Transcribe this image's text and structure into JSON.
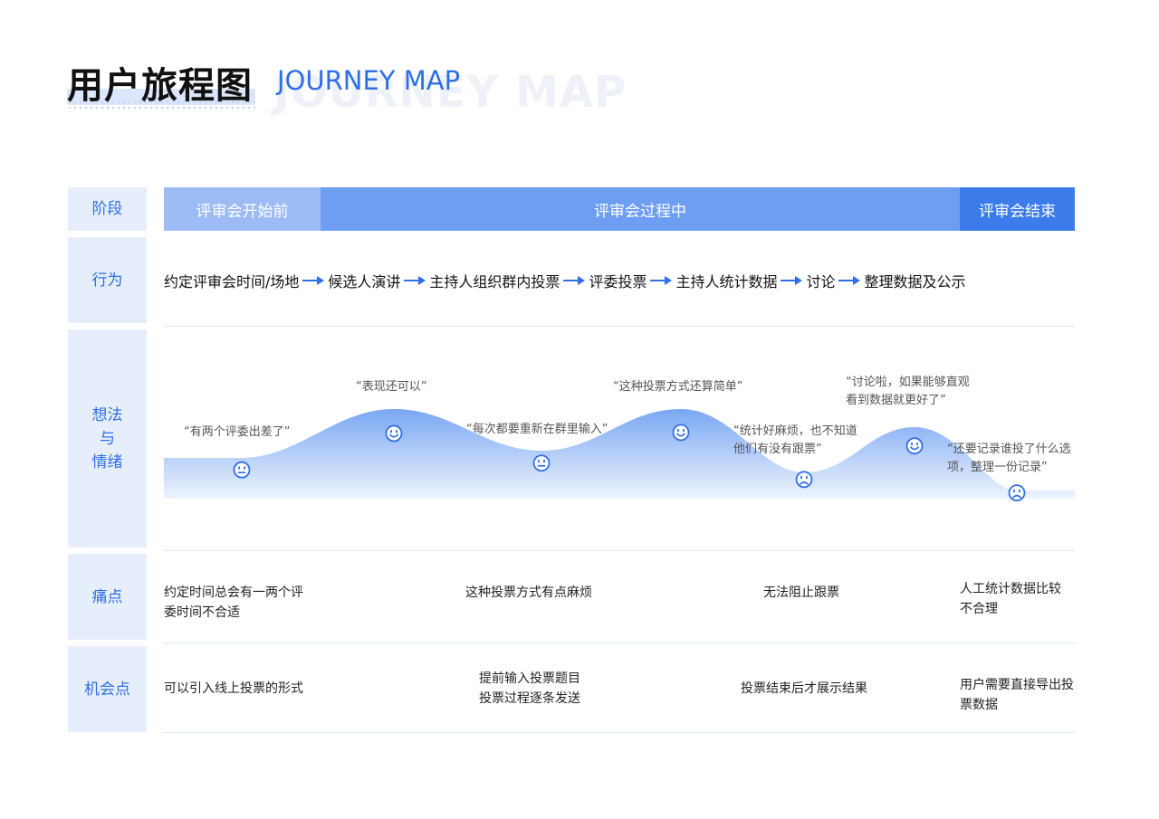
{
  "header": {
    "title_cn": "用户旅程图",
    "title_en": "JOURNEY MAP",
    "title_en_ghost": "JOURNEY MAP"
  },
  "labels": {
    "stage": "阶段",
    "action": "行为",
    "thought_line1": "想法",
    "thought_line2": "与",
    "thought_line3": "情绪",
    "pain": "痛点",
    "opportunity": "机会点"
  },
  "stages": [
    {
      "label": "评审会开始前",
      "color": "#9dbcf6"
    },
    {
      "label": "评审会过程中",
      "color": "#6e9ef2"
    },
    {
      "label": "评审会结束",
      "color": "#3b7bea"
    }
  ],
  "actions": [
    "约定评审会时间/场地",
    "候选人演讲",
    "主持人组织群内投票",
    "评委投票",
    "主持人统计数据",
    "讨论",
    "整理数据及公示"
  ],
  "emotions": [
    {
      "quote": "“有两个评委出差了”",
      "mood": "neutral",
      "emotion_level": 0.3
    },
    {
      "quote": "“表现还可以”",
      "mood": "happy",
      "emotion_level": 0.68
    },
    {
      "quote": "“每次都要重新在群里输入”",
      "mood": "neutral",
      "emotion_level": 0.37
    },
    {
      "quote": "“这种投票方式还算简单”",
      "mood": "happy",
      "emotion_level": 0.69
    },
    {
      "quote_line1": "“统计好麻烦，也不知道",
      "quote_line2": "他们有没有跟票”",
      "mood": "sad",
      "emotion_level": 0.2
    },
    {
      "quote_line1": "“讨论啦，如果能够直观",
      "quote_line2": "看到数据就更好了”",
      "mood": "happy",
      "emotion_level": 0.55
    },
    {
      "quote_line1": "“还要记录谁投了什么选",
      "quote_line2": "项，整理一份记录”",
      "mood": "sad",
      "emotion_level": 0.06
    }
  ],
  "pain_points": [
    {
      "line1": "约定时间总会有一两个评",
      "line2": "委时间不合适"
    },
    {
      "line1": "这种投票方式有点麻烦"
    },
    {
      "line1": "无法阻止跟票"
    },
    {
      "line1": "人工统计数据比较",
      "line2": "不合理"
    }
  ],
  "opportunities": [
    {
      "line1": "可以引入线上投票的形式"
    },
    {
      "line1": "提前输入投票题目",
      "line2": "投票过程逐条发送"
    },
    {
      "line1": "投票结束后才展示结果"
    },
    {
      "line1": "用户需要直接导出投",
      "line2": "票数据"
    }
  ],
  "colors": {
    "accent": "#2f6fe6",
    "label_bg": "#e6eefc",
    "wave_top": "#7aa7f3",
    "wave_bottom": "#eef4fe",
    "face": "#2f6fe6"
  }
}
